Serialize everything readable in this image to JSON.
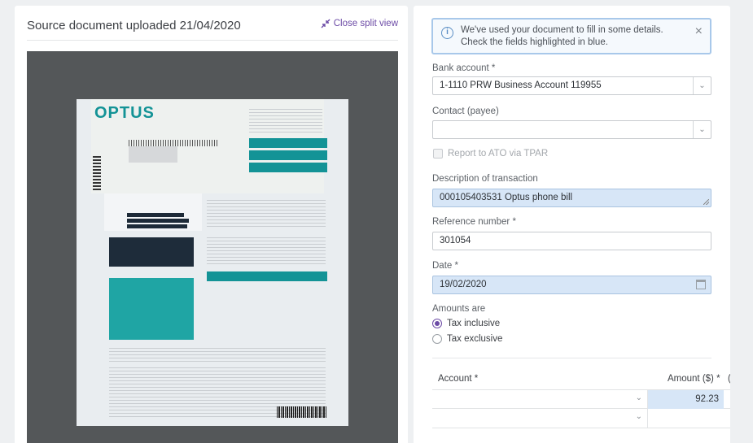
{
  "left": {
    "title": "Source document uploaded 21/04/2020",
    "close_split": "Close split view",
    "brand": "OPTUS"
  },
  "banner": {
    "message": "We've used your document to fill in some details. Check the fields highlighted in blue.",
    "info_glyph": "i",
    "close_glyph": "×"
  },
  "form": {
    "bank_account_label": "Bank account *",
    "bank_account_value": "1-1110 PRW Business Account 119955",
    "contact_label": "Contact (payee)",
    "contact_value": "",
    "report_tpar_label": "Report to ATO via TPAR",
    "description_label": "Description of transaction",
    "description_value": "000105403531 Optus phone bill",
    "reference_label": "Reference number *",
    "reference_value": "301054",
    "date_label": "Date *",
    "date_value": "19/02/2020",
    "amounts_are_label": "Amounts are",
    "tax_inclusive_label": "Tax inclusive",
    "tax_exclusive_label": "Tax exclusive",
    "amounts_are_selected": "Tax inclusive"
  },
  "table": {
    "account_header": "Account *",
    "amount_header": "Amount ($) *",
    "extra_header": "(",
    "rows": [
      {
        "account": "",
        "amount": "92.23"
      },
      {
        "account": "",
        "amount": ""
      }
    ]
  },
  "colors": {
    "accent_purple": "#6c4ba6",
    "highlight_blue": "#d7e6f7",
    "optus_teal": "#139396"
  },
  "icons": {
    "collapse": "collapse-arrows-icon",
    "info": "info-icon",
    "close": "close-icon",
    "chevron": "chevron-down-icon",
    "calendar": "calendar-icon"
  }
}
